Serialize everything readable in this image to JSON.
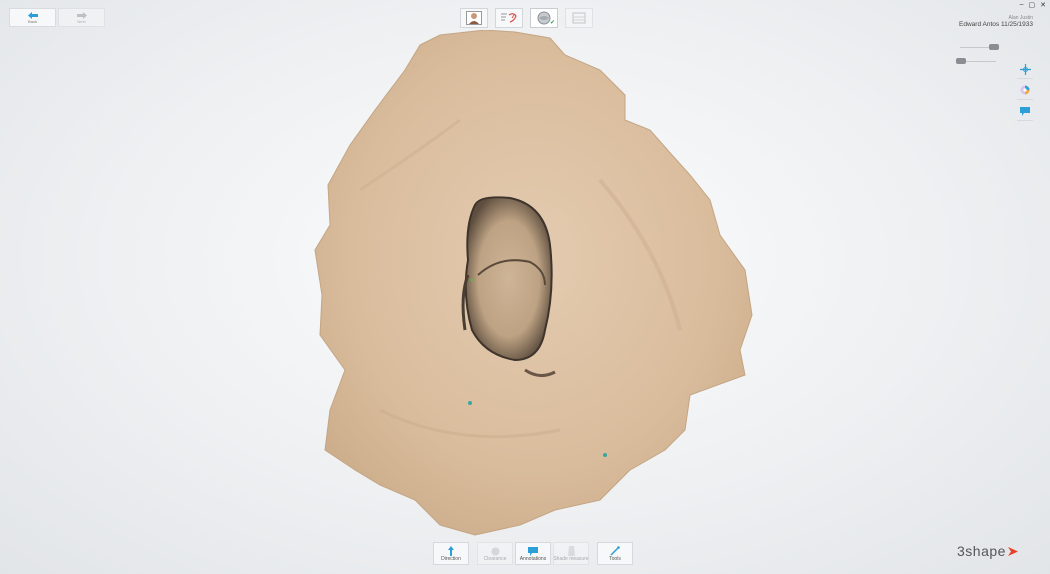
{
  "nav": {
    "back_label": "Back",
    "next_label": "Next"
  },
  "workflow": {
    "steps": [
      {
        "name": "patient-step",
        "icon": "patient-photo-icon",
        "active": false
      },
      {
        "name": "order-step",
        "icon": "order-form-icon",
        "active": false
      },
      {
        "name": "scan-step",
        "icon": "scan-globe-icon",
        "active": true,
        "completed": true
      },
      {
        "name": "send-step",
        "icon": "send-tray-icon",
        "active": false
      }
    ]
  },
  "header": {
    "user_name": "Alan Justin",
    "patient_label": "Edward Antos 11/25/1933"
  },
  "window_controls": [
    "–",
    "▢",
    "✕"
  ],
  "sliders": [
    {
      "name": "upper-jaw-slider",
      "icon": "upper-jaw-icon",
      "value": 1.0
    },
    {
      "name": "lower-jaw-slider",
      "icon": "lower-jaw-icon",
      "value": 0.0
    }
  ],
  "right_tools": [
    {
      "name": "view-orientation-button",
      "icon": "crosshair-icon"
    },
    {
      "name": "color-toggle-button",
      "icon": "color-wheel-icon"
    },
    {
      "name": "comment-button",
      "icon": "comment-icon"
    }
  ],
  "bottom_toolbar": {
    "direction": "Direction",
    "clearance": "Clearance",
    "annotations": "Annotations",
    "shade_measure": "Shade measure",
    "tools": "Tools"
  },
  "brand": {
    "logo_text": "3shape",
    "accent_color": "#e8412b",
    "ui_accent": "#2d9fd8"
  }
}
